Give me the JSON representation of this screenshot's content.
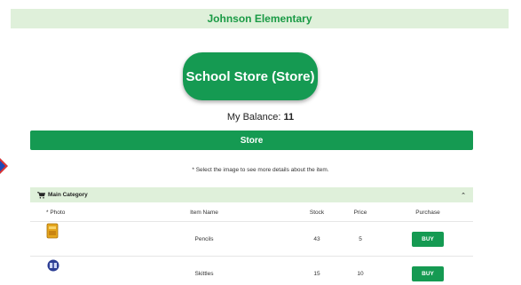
{
  "school": {
    "name": "Johnson Elementary"
  },
  "store": {
    "title": "School Store (Store)",
    "tab_label": "Store"
  },
  "balance": {
    "label": "My Balance:",
    "value": "11"
  },
  "hint": "* Select the image to see more details about the item.",
  "category": {
    "name": "Main Category",
    "icon": "cart-icon",
    "toggle_icon": "chevron-up-icon"
  },
  "table": {
    "headers": {
      "photo": "* Photo",
      "name": "Item Name",
      "stock": "Stock",
      "price": "Price",
      "purchase": "Purchase"
    },
    "rows": [
      {
        "icon": "pencil-box-icon",
        "name": "Pencils",
        "stock": "43",
        "price": "5",
        "buy_label": "BUY"
      },
      {
        "icon": "candy-icon",
        "name": "Skittles",
        "stock": "15",
        "price": "10",
        "buy_label": "BUY"
      }
    ]
  },
  "colors": {
    "brand_green": "#159a52",
    "light_green": "#dff0da",
    "title_green": "#1a9a45"
  }
}
